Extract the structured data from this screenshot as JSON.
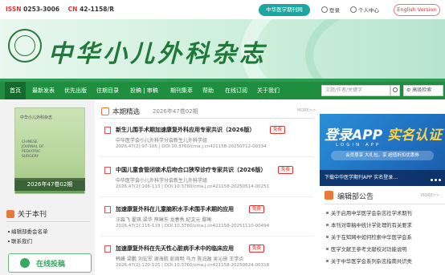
{
  "topbar": {
    "issn_label": "ISSN",
    "issn_value": "0253-3006",
    "cn_label": "CN",
    "cn_value": "42-1158/R",
    "network_button": "中华医学期刊网",
    "login": "登录",
    "personal_center": "个人中心",
    "english_version": "English Version"
  },
  "banner": {
    "title": "中华小儿外科杂志"
  },
  "nav": {
    "items": [
      "首页",
      "最新发表",
      "优先出版",
      "往期目录",
      "投稿 | 审稿",
      "期刊集萃",
      "帮助",
      "在线订阅",
      "关于我们"
    ],
    "search_placeholder": "文题/作者/关键字",
    "advanced_search": "高级检索"
  },
  "cover": {
    "cn_title": "中华小儿外科杂志",
    "en_title": "CHINESE JOURNAL OF PEDIATRIC SURGERY",
    "issue_label": "2026年47卷02期"
  },
  "about": {
    "heading": "关于本刊",
    "links": [
      "编辑部委会名单",
      "联系我们"
    ],
    "submit_label": "在线投稿"
  },
  "featured": {
    "heading": "本期精选",
    "issue": "2026年47卷02期",
    "more": "MORE>>",
    "articles": [
      {
        "title": "新生儿围手术期加速康复外科应用专家共识（2026版）",
        "tag": "免费",
        "authors": "中华医学会小儿外科学分会新生儿外科学组",
        "meta": "2026,47(2):97-105 | DOI:10.3760/cma.j.cn421158-20250712-00334"
      },
      {
        "title": "中国儿童食管闭锁术后吻合口狭窄诊疗专家共识（2026版）",
        "tag": "免费",
        "authors": "中华医学会小儿外科学分会新生儿外科学组",
        "meta": "2026,47(2):106-113 | DOI:10.3760/cma.j.cn421158-20250514-00251"
      },
      {
        "title": "加速康复外科在儿童脑积水手术围手术期的应用",
        "tag": "免费",
        "authors": "汪淼飞 翟琪 梁华 熊琳东 龙春秀 纪文元 鄢晰",
        "meta": "2026,47(2):116-119 | DOI:10.3760/cma.j.cn421158-20251110-00494"
      },
      {
        "title": "加速康复外科在先天性心脏病手术中的临床应用",
        "tag": "免费",
        "authors": "韩峰 梁鹏 刘宏军 谢海航 彭周明 马力 陈泊政 吴沁璟 王学点",
        "meta": "2026,47(2):120-125 | DOI:10.3760/cma.j.cn421158-20250624-00318"
      }
    ]
  },
  "app_ad": {
    "line1_a": "登录APP",
    "line1_b": "实名认证",
    "line2": "LOGIN APP",
    "line3": "会员尊享 大礼包，享 超值折扣优惠券",
    "bottom": "下载中华医学期刊APP 实名登录…"
  },
  "notices": {
    "heading": "编辑部公告",
    "more": "MORE>>",
    "items": [
      "关于启用中华医学会杂志社学术期刊",
      "本刊对审稿中统计学处理的有关要求",
      "关于在知网中如何检索中华医学会系",
      "医学文献王参考文献校对功能说明",
      "关于中华医学会系列杂志指南共识类"
    ]
  },
  "colors": {
    "nav_green": "#1f8f3f",
    "title_green": "#1f7a3a",
    "issn_red": "#d33333",
    "accent_orange": "#e77a3a",
    "network_teal": "#1ba6a0"
  }
}
